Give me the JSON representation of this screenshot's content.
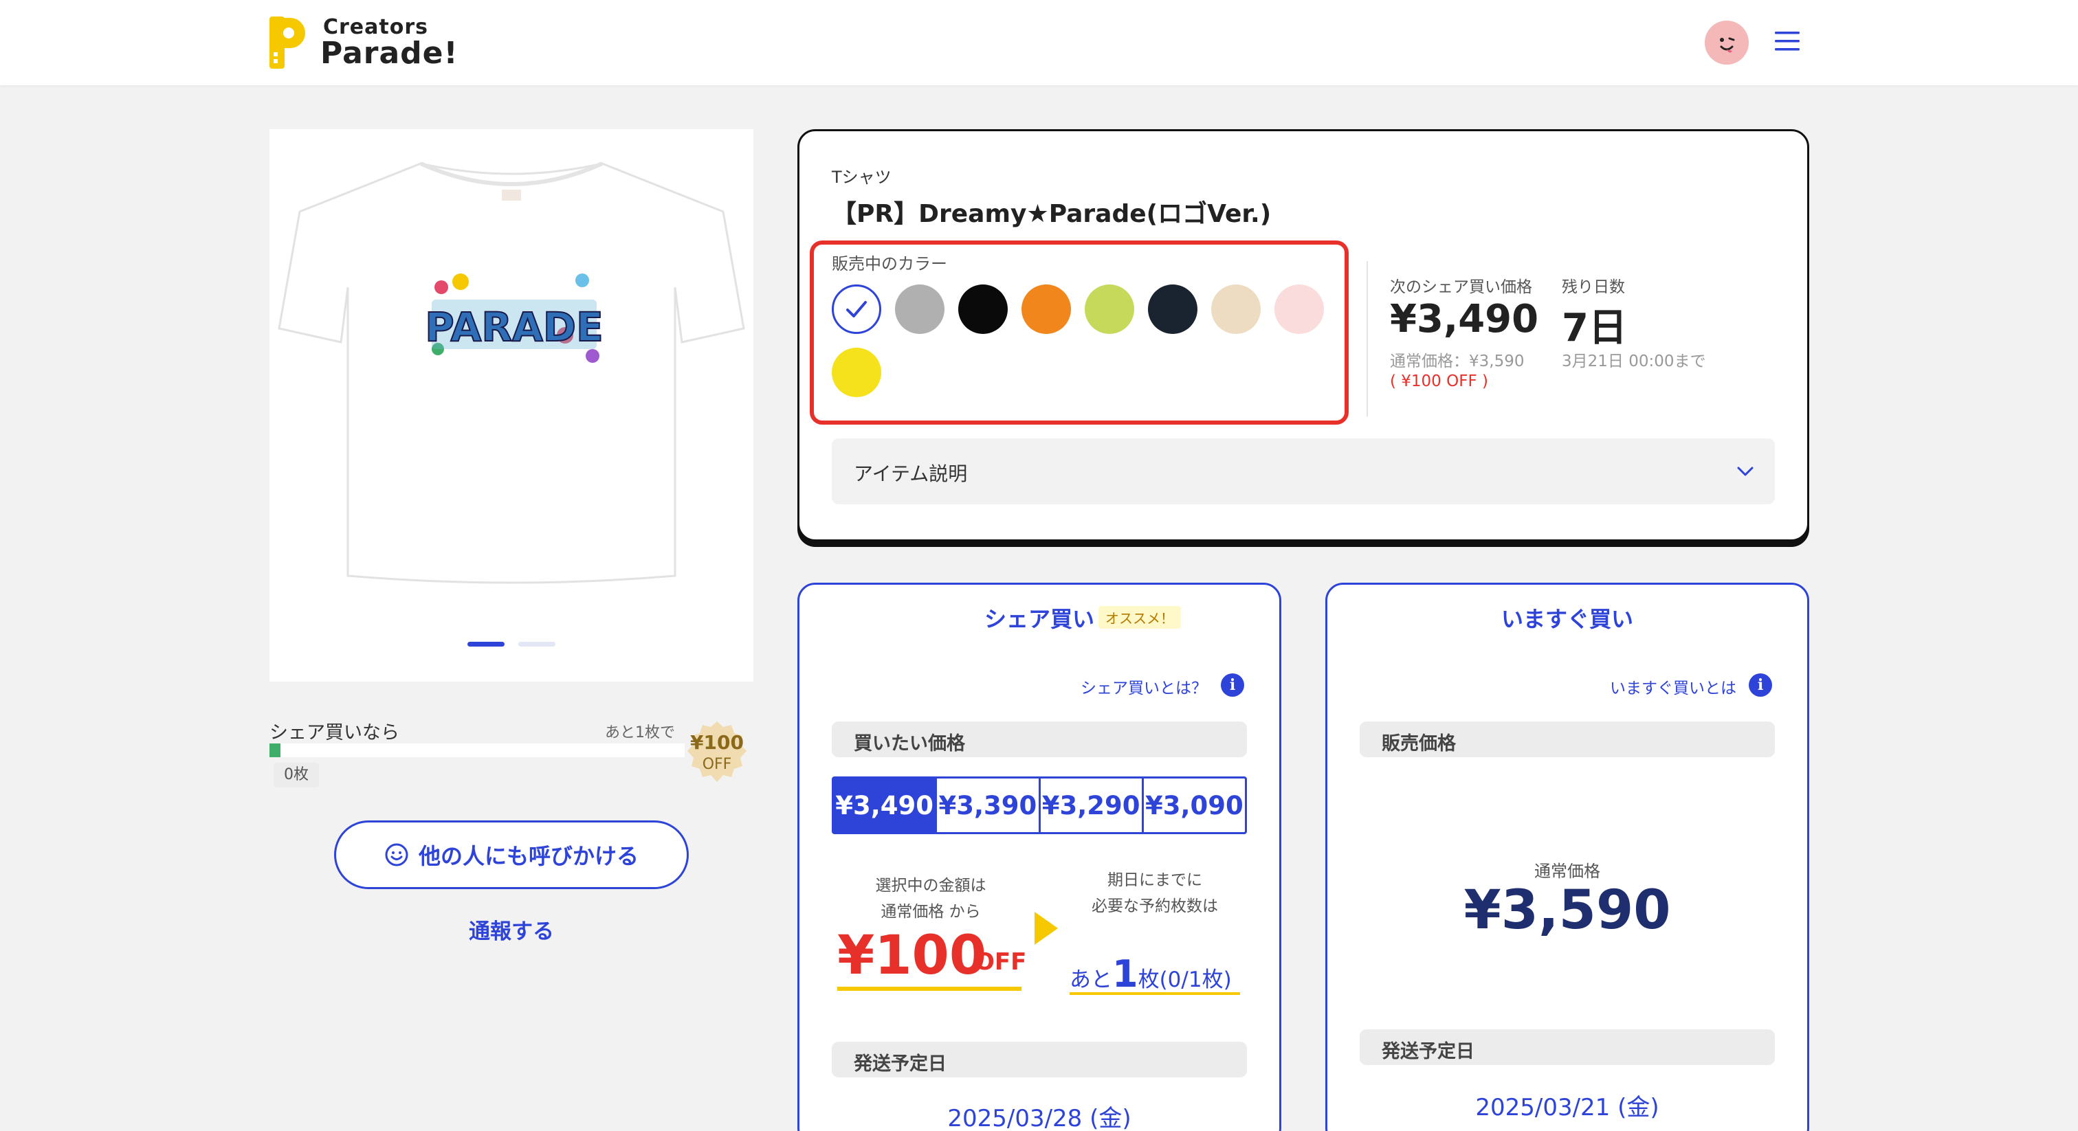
{
  "header": {
    "logo_top": "Creators",
    "logo_bottom": "Parade!"
  },
  "gallery": {
    "shirt_print_text": "PARADE",
    "slides": 2,
    "active_slide": 1
  },
  "share_progress": {
    "label": "シェア買いなら",
    "remaining_text": "あと1枚で",
    "count_badge": "0枚",
    "seal_amount": "¥100",
    "seal_off": "OFF",
    "progress": 0
  },
  "call_button": {
    "label": "他の人にも呼びかける",
    "icon": "smile-icon"
  },
  "report_link": "通報する",
  "product": {
    "category": "Tシャツ",
    "title": "【PR】Dreamy★Parade(ロゴVer.)",
    "colors_label": "販売中のカラー",
    "colors": [
      {
        "name": "white",
        "hex": "#ffffff",
        "selected": true
      },
      {
        "name": "gray",
        "hex": "#b0b0b0",
        "selected": false
      },
      {
        "name": "black",
        "hex": "#0a0a0a",
        "selected": false
      },
      {
        "name": "orange",
        "hex": "#f0861c",
        "selected": false
      },
      {
        "name": "lime",
        "hex": "#c6d95a",
        "selected": false
      },
      {
        "name": "navy",
        "hex": "#1a2330",
        "selected": false
      },
      {
        "name": "natural",
        "hex": "#eddcc2",
        "selected": false
      },
      {
        "name": "pink",
        "hex": "#fbdcdc",
        "selected": false
      },
      {
        "name": "yellow",
        "hex": "#f6e21c",
        "selected": false
      }
    ],
    "next_price_label": "次のシェア買い価格",
    "next_price": "¥3,490",
    "normal_price": "通常価格：¥3,590",
    "off_note": "( ¥100 OFF )",
    "days_label": "残り日数",
    "days_value": "7日",
    "deadline": "3月21日 00:00まで",
    "description_label": "アイテム説明"
  },
  "share_buy": {
    "title": "シェア買い",
    "badge": "オススメ！",
    "help_link": "シェア買いとは？",
    "price_section": "買いたい価格",
    "price_options": [
      "¥3,490",
      "¥3,390",
      "¥3,290",
      "¥3,090"
    ],
    "selected_index": 0,
    "note_left_1": "選択中の金額は",
    "note_left_2": "通常価格 から",
    "off_amount": "¥100",
    "off_suffix": "OFF",
    "note_right_1": "期日にまでに",
    "note_right_2": "必要な予約枚数は",
    "remain_prefix": "あと",
    "remain_num": "1",
    "remain_suffix": "枚(0/1枚)",
    "ship_section": "発送予定日",
    "ship_date": "2025/03/28 (金)"
  },
  "buy_now": {
    "title": "いますぐ買い",
    "help_link": "いますぐ買いとは",
    "price_section": "販売価格",
    "normal_label": "通常価格",
    "normal_value": "¥3,590",
    "ship_section": "発送予定日",
    "ship_date": "2025/03/21 (金)"
  },
  "colors": {
    "accent": "#2e43d8",
    "alert": "#e8302a",
    "highlight": "#f5c800",
    "price_dark": "#1f2e6e"
  }
}
